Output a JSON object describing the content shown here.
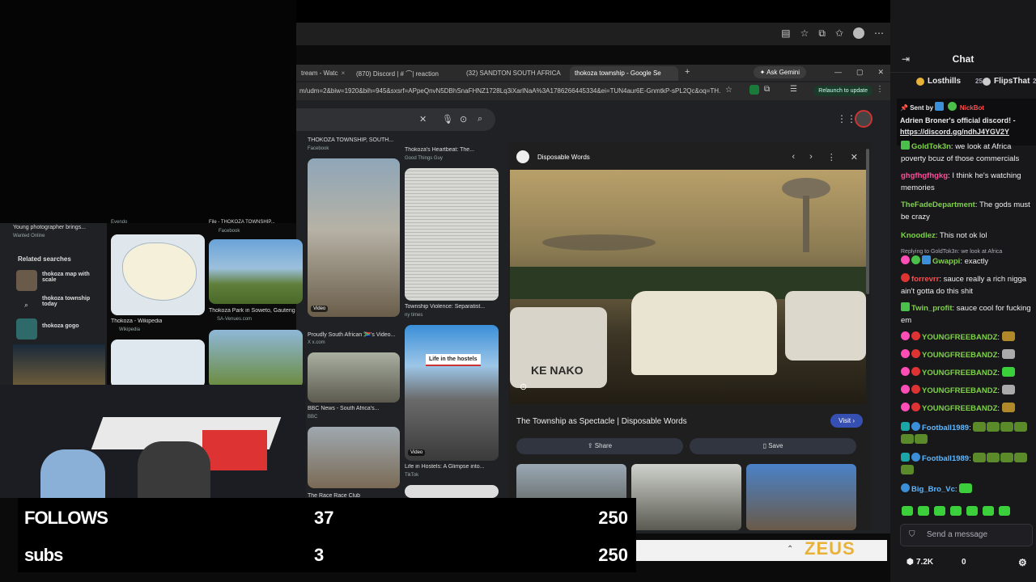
{
  "inner_browser": {
    "tabs": [
      {
        "label": "tream - Watc",
        "active": false
      },
      {
        "label": "(870) Discord | # ⌒| reaction",
        "active": false
      },
      {
        "label": "(32) SANDTON SOUTH AFRICA",
        "active": false
      },
      {
        "label": "thokoza township - Google Se",
        "active": true
      }
    ],
    "ask_gemini": "Ask Gemini",
    "url": "m/udm=2&biw=1920&bih=945&sxsrf=APpeQnvN5DBhSnaFHNZ1728Lq3iXarlNaA%3A1786266445334&ei=TUN4aur6E-GnmtkP-sPL2Qc&oq=TH...",
    "relaunch": "Relaunch to update"
  },
  "results": [
    {
      "caption": "THOKOZA TOWNSHIP, SOUTH...",
      "source": "Facebook"
    },
    {
      "caption": "Thokoza's Heartbeat: The...",
      "source": "Good Things Guy"
    },
    {
      "caption": "Young photographer brings...",
      "source": "Wanted Online"
    },
    {
      "caption": "Evendo",
      "source": ""
    },
    {
      "caption": "File - THOKOZA TOWNSHIP...",
      "source": "Facebook"
    },
    {
      "caption": "Thokoza - Wikipedia",
      "source": "Wikipedia"
    },
    {
      "caption": "Thokoza Park in Soweto, Gauteng",
      "source": "SA-Venues.com"
    },
    {
      "caption": "Proudly South African 🇿🇦's Video...",
      "source": "X x.com"
    },
    {
      "caption": "Township Violence: Separatist...",
      "source": "ny times"
    },
    {
      "caption": "BBC News - South Africa's...",
      "source": "BBC"
    },
    {
      "caption": "Life in Hostels: A Glimpse into...",
      "source": "TikTok"
    },
    {
      "caption": "The Race Race Club",
      "source": ""
    }
  ],
  "video_label": "Video",
  "hostels_text": "Life in the hostels",
  "related": {
    "title": "Related searches",
    "items": [
      "thokoza map with scale",
      "thokoza township today",
      "thokoza gogo"
    ]
  },
  "detail": {
    "site": "Disposable Words",
    "title": "The Township as Spectacle | Disposable Words",
    "visit": "Visit",
    "share": "Share",
    "save": "Save",
    "van_text": "KE NAKO"
  },
  "stats": {
    "follows_label": "FOLLOWS",
    "follows_current": "37",
    "follows_goal": "250",
    "subs_label": "subs",
    "subs_current": "3",
    "subs_goal": "250"
  },
  "overlay_logo": "ZEUS",
  "chat": {
    "title": "Chat",
    "top_gifters": [
      {
        "name": "Losthills",
        "count": "25"
      },
      {
        "name": "FlipsThat",
        "count": "2"
      }
    ],
    "pinned": {
      "sent_by": "Sent by",
      "bot": "NickBot",
      "text": "Adrien Broner's official discord! -",
      "link": "https://discord.gg/ndhJ4YGV2Y"
    },
    "messages": [
      {
        "user": "GoldTok3n",
        "color": "#7fd14a",
        "text": "we look at Africa poverty bcuz of those commercials"
      },
      {
        "user": "ghgfhgfhgkg",
        "color": "#ff4d9a",
        "text": "I think he's watching memories"
      },
      {
        "user": "TheFadeDepartment",
        "color": "#7fd14a",
        "text": "The gods must be crazy"
      },
      {
        "user": "Knoodlez",
        "color": "#7fd14a",
        "text": "This not ok lol"
      },
      {
        "user": "Gwappi",
        "color": "#7fd14a",
        "text": "exactly",
        "reply": "Replying to GoldTok3n: we look at Africa"
      },
      {
        "user": "forrevrr",
        "color": "#ff4d4d",
        "text": "sauce really a rich nigga ain't gotta do this shit"
      },
      {
        "user": "Twin_profit",
        "color": "#7fd14a",
        "text": "sauce cool for fucking em"
      },
      {
        "user": "YOUNGFREEBANDZ",
        "color": "#7fd14a",
        "text": ""
      },
      {
        "user": "YOUNGFREEBANDZ",
        "color": "#7fd14a",
        "text": ""
      },
      {
        "user": "YOUNGFREEBANDZ",
        "color": "#7fd14a",
        "text": ""
      },
      {
        "user": "YOUNGFREEBANDZ",
        "color": "#7fd14a",
        "text": ""
      },
      {
        "user": "YOUNGFREEBANDZ",
        "color": "#7fd14a",
        "text": ""
      },
      {
        "user": "Football1989",
        "color": "#5eb8ff",
        "text": ""
      },
      {
        "user": "Football1989",
        "color": "#5eb8ff",
        "text": ""
      },
      {
        "user": "Big_Bro_Vc",
        "color": "#5eb8ff",
        "text": ""
      }
    ],
    "send_placeholder": "Send a message",
    "points": "7.2K",
    "zero": "0"
  }
}
